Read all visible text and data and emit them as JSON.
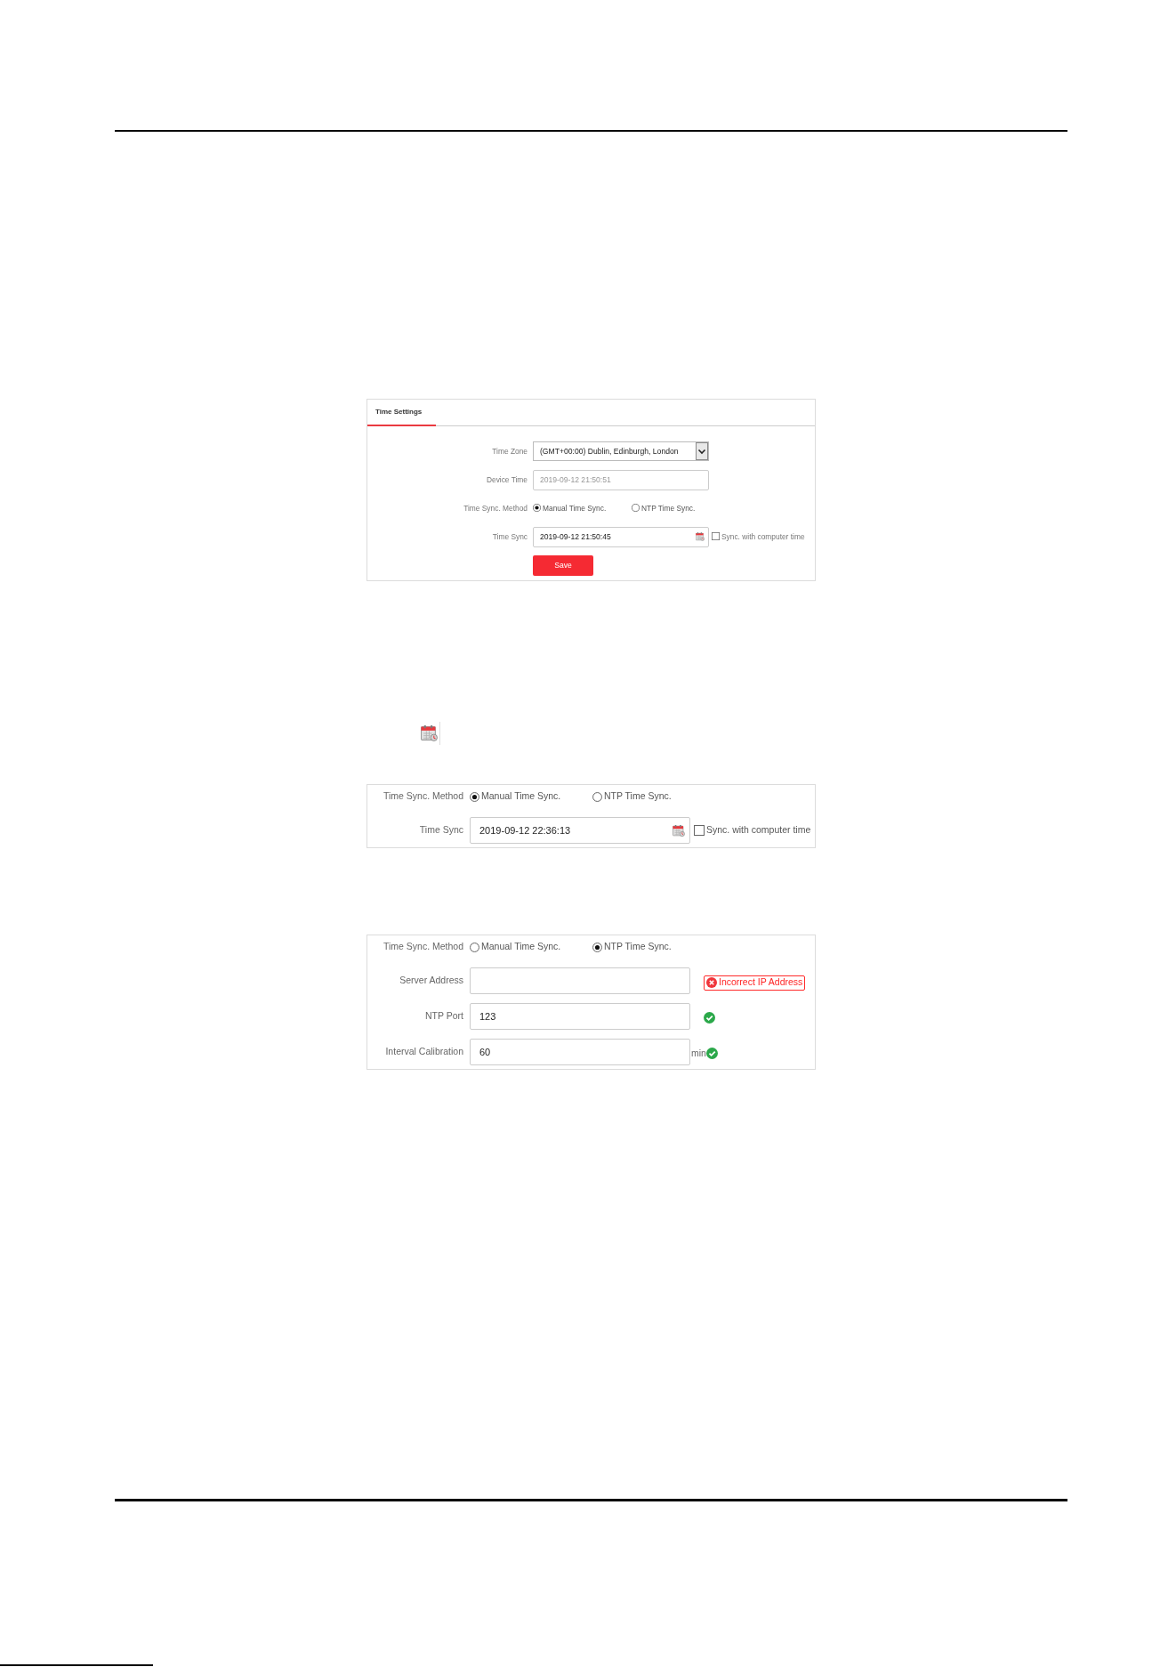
{
  "blocks": [
    {
      "kind": "settings_panel",
      "tab": {
        "label": "Time Settings",
        "selected": true
      },
      "rows": [
        {
          "kind": "select",
          "label": "Time Zone",
          "value": "(GMT+00:00) Dublin, Edinburgh, London",
          "disabled": false
        },
        {
          "kind": "text",
          "label": "Device Time",
          "value": "2019-09-12 21:50:51",
          "disabled": true
        },
        {
          "kind": "radio",
          "label": "Time Sync. Method",
          "options": [
            {
              "label": "Manual Time Sync.",
              "selected": true
            },
            {
              "label": "NTP Time Sync.",
              "selected": false
            }
          ]
        },
        {
          "kind": "datetime",
          "label": "Time Sync",
          "value": "2019-09-12 21:50:45",
          "disabled": false,
          "checkbox": {
            "label": "Sync. with computer time",
            "checked": false
          }
        },
        {
          "kind": "button",
          "label": "Save"
        }
      ]
    },
    {
      "kind": "calendar_icon"
    },
    {
      "kind": "form_panel",
      "rows": [
        {
          "kind": "radio",
          "label": "Time Sync. Method",
          "options": [
            {
              "label": "Manual Time Sync.",
              "selected": true
            },
            {
              "label": "NTP Time Sync.",
              "selected": false
            }
          ]
        },
        {
          "kind": "datetime",
          "label": "Time Sync",
          "value": "2019-09-12 22:36:13",
          "disabled": false,
          "checkbox": {
            "label": "Sync. with computer time",
            "checked": false
          }
        }
      ]
    },
    {
      "kind": "form_panel",
      "rows": [
        {
          "kind": "radio",
          "label": "Time Sync. Method",
          "options": [
            {
              "label": "Manual Time Sync.",
              "selected": false
            },
            {
              "label": "NTP Time Sync.",
              "selected": true
            }
          ]
        },
        {
          "kind": "text",
          "label": "Server Address",
          "status": {
            "kind": "error",
            "text": "Incorrect IP Address"
          }
        },
        {
          "kind": "text",
          "label": "NTP Port",
          "value": "123",
          "disabled": false,
          "status": {
            "kind": "valid"
          }
        },
        {
          "kind": "text",
          "label": "Interval Calibration",
          "value": "60",
          "unit": "min",
          "disabled": false,
          "status": {
            "kind": "valid"
          }
        }
      ]
    }
  ]
}
